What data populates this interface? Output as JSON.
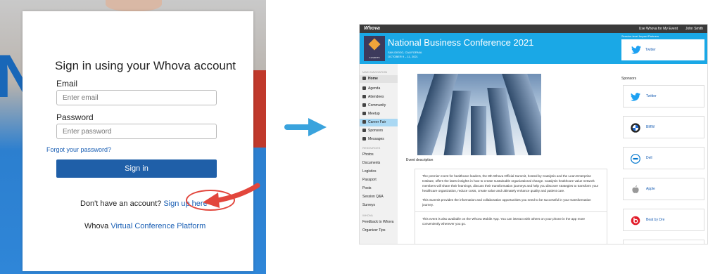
{
  "signin": {
    "title": "Sign in using your Whova account",
    "email_label": "Email",
    "email_placeholder": "Enter email",
    "password_label": "Password",
    "password_placeholder": "Enter password",
    "forgot": "Forgot your password?",
    "button": "Sign in",
    "no_account": "Don't have an account?",
    "signup": "Sign up here",
    "footer_prefix": "Whova",
    "footer_link": "Virtual Conference Platform"
  },
  "app": {
    "brand": "Whova",
    "topbar": {
      "use_whova": "Use Whova for My Event",
      "user": "John Smith"
    },
    "event": {
      "title": "National Business Conference 2021",
      "location": "SAN DIEGO, CALIFORNIA",
      "dates": "OCTOBER 9 – 11, 2021",
      "logo_caption": "X-EVENTS"
    },
    "partner_label": "Session-level Impact Partners",
    "partner_name": "Twitter",
    "nav": {
      "main_header": "MAIN NAVIGATION",
      "items": [
        "Home",
        "Agenda",
        "Attendees",
        "Community",
        "Meetup",
        "Career Fair",
        "Sponsors",
        "Messages"
      ],
      "resources_header": "RESOURCES",
      "resources": [
        "Photos",
        "Documents",
        "Logistics",
        "Passport",
        "Posts",
        "Session Q&A",
        "Surveys"
      ],
      "whova_header": "WHOVA",
      "whova_items": [
        "Feedback to Whova",
        "Organizer Tips"
      ]
    },
    "event_description_label": "Event description",
    "description": [
      "The premier event for healthcare leaders, the 8th Whova Official Summit, hosted by Catalysis and the Lean Enterprise Institute, offers the latest insights in how to create sustainable organizational change. Catalysis healthcare value network members will share their learnings, discuss their transformation journeys and help you discover strategies to transform your healthcare organization, reduce costs, create value and ultimately enhance quality and patient care.",
      "This Summit provides the information and collaboration opportunities you need to be successful in your transformation journey.",
      "This event is also available on the Whova Mobile App. You can interact with others on your phone in the app more conveniently wherever you go."
    ],
    "sponsors_label": "Sponsors",
    "sponsors": [
      "Twitter",
      "BMW",
      "Dell",
      "Apple",
      "Beat by Dre"
    ]
  },
  "colors": {
    "whova_blue": "#1f5fa8",
    "banner_blue": "#1aa8e6",
    "annotation_red": "#e2463c",
    "arrow_blue": "#3aa3dd"
  }
}
